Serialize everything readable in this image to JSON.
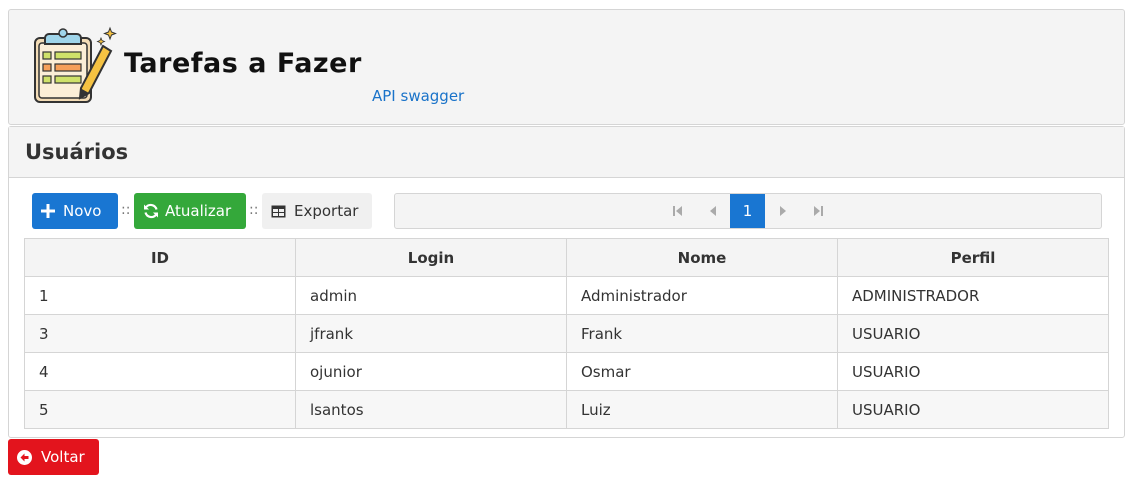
{
  "header": {
    "title": "Tarefas a Fazer",
    "api_link": "API swagger",
    "logo_icon": "clipboard-pencil-icon"
  },
  "panel": {
    "title": "Usuários"
  },
  "toolbar": {
    "novo_label": "Novo",
    "atualizar_label": "Atualizar",
    "exportar_label": "Exportar",
    "separator": "::"
  },
  "paginator": {
    "current_page": "1"
  },
  "table": {
    "columns": [
      "ID",
      "Login",
      "Nome",
      "Perfil"
    ],
    "rows": [
      [
        "1",
        "admin",
        "Administrador",
        "ADMINISTRADOR"
      ],
      [
        "3",
        "jfrank",
        "Frank",
        "USUARIO"
      ],
      [
        "4",
        "ojunior",
        "Osmar",
        "USUARIO"
      ],
      [
        "5",
        "lsantos",
        "Luiz",
        "USUARIO"
      ]
    ]
  },
  "footer": {
    "voltar_label": "Voltar"
  },
  "colors": {
    "primary": "#1976d2",
    "success": "#34a83a",
    "danger": "#e3141d"
  }
}
